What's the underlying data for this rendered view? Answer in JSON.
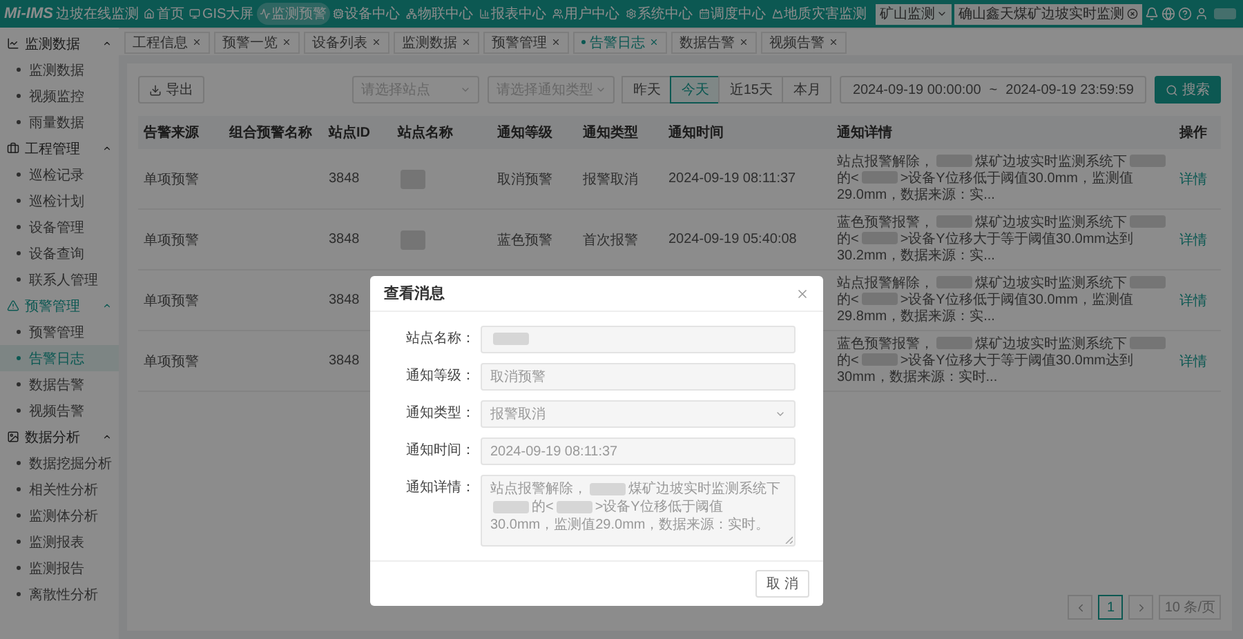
{
  "header": {
    "logo": "Mi-IMS",
    "subtitle": "边坡在线监测",
    "nav": [
      {
        "label": "首页",
        "selected": false
      },
      {
        "label": "GIS大屏",
        "selected": false
      },
      {
        "label": "监测预警",
        "selected": true
      },
      {
        "label": "设备中心",
        "selected": false
      },
      {
        "label": "物联中心",
        "selected": false
      },
      {
        "label": "报表中心",
        "selected": false
      },
      {
        "label": "用户中心",
        "selected": false
      },
      {
        "label": "系统中心",
        "selected": false
      },
      {
        "label": "调度中心",
        "selected": false
      },
      {
        "label": "地质灾害监测",
        "selected": false
      }
    ],
    "project_select": "矿山监测",
    "site_field": "确山鑫天煤矿边坡实时监测"
  },
  "tabs": [
    {
      "label": "工程信息",
      "selected": false
    },
    {
      "label": "预警一览",
      "selected": false
    },
    {
      "label": "设备列表",
      "selected": false
    },
    {
      "label": "监测数据",
      "selected": false
    },
    {
      "label": "预警管理",
      "selected": false
    },
    {
      "label": "告警日志",
      "selected": true
    },
    {
      "label": "数据告警",
      "selected": false
    },
    {
      "label": "视频告警",
      "selected": false
    }
  ],
  "sidebar": {
    "groups": [
      {
        "label": "监测数据",
        "expanded": true,
        "children": [
          {
            "label": "监测数据",
            "selected": false
          },
          {
            "label": "视频监控",
            "selected": false
          },
          {
            "label": "雨量数据",
            "selected": false
          }
        ]
      },
      {
        "label": "工程管理",
        "expanded": true,
        "children": [
          {
            "label": "巡检记录",
            "selected": false
          },
          {
            "label": "巡检计划",
            "selected": false
          },
          {
            "label": "设备管理",
            "selected": false
          },
          {
            "label": "设备查询",
            "selected": false
          },
          {
            "label": "联系人管理",
            "selected": false
          }
        ]
      },
      {
        "label": "预警管理",
        "expanded": true,
        "children": [
          {
            "label": "预警管理",
            "selected": false
          },
          {
            "label": "告警日志",
            "selected": true
          },
          {
            "label": "数据告警",
            "selected": false
          },
          {
            "label": "视频告警",
            "selected": false
          }
        ]
      },
      {
        "label": "数据分析",
        "expanded": true,
        "children": [
          {
            "label": "数据挖掘分析",
            "selected": false
          },
          {
            "label": "相关性分析",
            "selected": false
          },
          {
            "label": "监测体分析",
            "selected": false
          },
          {
            "label": "监测报表",
            "selected": false
          },
          {
            "label": "监测报告",
            "selected": false
          },
          {
            "label": "离散性分析",
            "selected": false
          }
        ]
      }
    ]
  },
  "toolbar": {
    "export": "导出",
    "site_select": {
      "placeholder": "请选择站点"
    },
    "type_select": {
      "placeholder": "请选择通知类型"
    },
    "ranges": [
      {
        "label": "昨天",
        "selected": false
      },
      {
        "label": "今天",
        "selected": true
      },
      {
        "label": "近15天",
        "selected": false
      },
      {
        "label": "本月",
        "selected": false
      }
    ],
    "date_start": "2024-09-19 00:00:00",
    "date_separator": "~",
    "date_end": "2024-09-19 23:59:59",
    "search": "搜索"
  },
  "table": {
    "columns": [
      "告警来源",
      "组合预警名称",
      "站点ID",
      "站点名称",
      "通知等级",
      "通知类型",
      "通知时间",
      "通知详情",
      "操作"
    ],
    "rows": [
      {
        "source": "单项预警",
        "site_id": "3848",
        "site_name": [
          {
            "kind": "redacted"
          }
        ],
        "level": "取消预警",
        "type": "报警取消",
        "time": "2024-09-19 08:11:37",
        "detail": [
          {
            "kind": "text",
            "text": "站点报警解除，"
          },
          {
            "kind": "redacted"
          },
          {
            "kind": "text",
            "text": "煤矿边坡实时监测系统下"
          },
          {
            "kind": "redacted"
          },
          {
            "kind": "text",
            "text": "的<"
          },
          {
            "kind": "redacted"
          },
          {
            "kind": "text",
            "text": ">设备Y位移低于阈值30.0mm，监测值29.0mm，数据来源：实..."
          }
        ],
        "action": "详情"
      },
      {
        "source": "单项预警",
        "site_id": "3848",
        "site_name": [
          {
            "kind": "redacted"
          }
        ],
        "level": "蓝色预警",
        "type": "首次报警",
        "time": "2024-09-19 05:40:08",
        "detail": [
          {
            "kind": "text",
            "text": "蓝色预警报警，"
          },
          {
            "kind": "redacted"
          },
          {
            "kind": "text",
            "text": "煤矿边坡实时监测系统下"
          },
          {
            "kind": "redacted"
          },
          {
            "kind": "text",
            "text": "的<"
          },
          {
            "kind": "redacted"
          },
          {
            "kind": "text",
            "text": ">设备Y位移大于等于阈值30.0mm达到30.2mm，数据来源：实..."
          }
        ],
        "action": "详情"
      },
      {
        "source": "单项预警",
        "site_id": "3848",
        "detail": [
          {
            "kind": "text",
            "text": "站点报警解除，"
          },
          {
            "kind": "redacted"
          },
          {
            "kind": "text",
            "text": "煤矿边坡实时监测系统下"
          },
          {
            "kind": "redacted"
          },
          {
            "kind": "text",
            "text": "的<"
          },
          {
            "kind": "redacted"
          },
          {
            "kind": "text",
            "text": ">设备Y位移低于阈值30.0mm，监测值29.8mm，数据来源：实..."
          }
        ],
        "action": "详情"
      },
      {
        "source": "单项预警",
        "site_id": "3848",
        "detail": [
          {
            "kind": "text",
            "text": "蓝色预警报警，"
          },
          {
            "kind": "redacted"
          },
          {
            "kind": "text",
            "text": "煤矿边坡实时监测系统下"
          },
          {
            "kind": "redacted"
          },
          {
            "kind": "text",
            "text": "的<"
          },
          {
            "kind": "redacted"
          },
          {
            "kind": "text",
            "text": ">设备Y位移大于等于阈值30.0mm达到30mm，数据来源：实时..."
          }
        ],
        "action": "详情"
      }
    ]
  },
  "pagination": {
    "page": "1",
    "page_size": "10 条/页"
  },
  "modal": {
    "title": "查看消息",
    "fields": [
      {
        "kind": "input",
        "label": "站点名称：",
        "value": [
          {
            "kind": "redacted"
          }
        ]
      },
      {
        "kind": "input",
        "label": "通知等级：",
        "value": [
          {
            "kind": "text",
            "text": "取消预警"
          }
        ]
      },
      {
        "kind": "select",
        "label": "通知类型：",
        "value": [
          {
            "kind": "text",
            "text": "报警取消"
          }
        ]
      },
      {
        "kind": "input",
        "label": "通知时间：",
        "value": [
          {
            "kind": "text",
            "text": "2024-09-19 08:11:37"
          }
        ]
      },
      {
        "kind": "textarea",
        "label": "通知详情：",
        "value": [
          {
            "kind": "text",
            "text": "站点报警解除，"
          },
          {
            "kind": "redacted"
          },
          {
            "kind": "text",
            "text": "煤矿边坡实时监测系统下"
          },
          {
            "kind": "redacted"
          },
          {
            "kind": "text",
            "text": "的<"
          },
          {
            "kind": "redacted"
          },
          {
            "kind": "text",
            "text": ">设备Y位移低于阈值30.0mm，监测值29.0mm，数据来源：实时。"
          }
        ]
      }
    ],
    "cancel": "取 消"
  }
}
